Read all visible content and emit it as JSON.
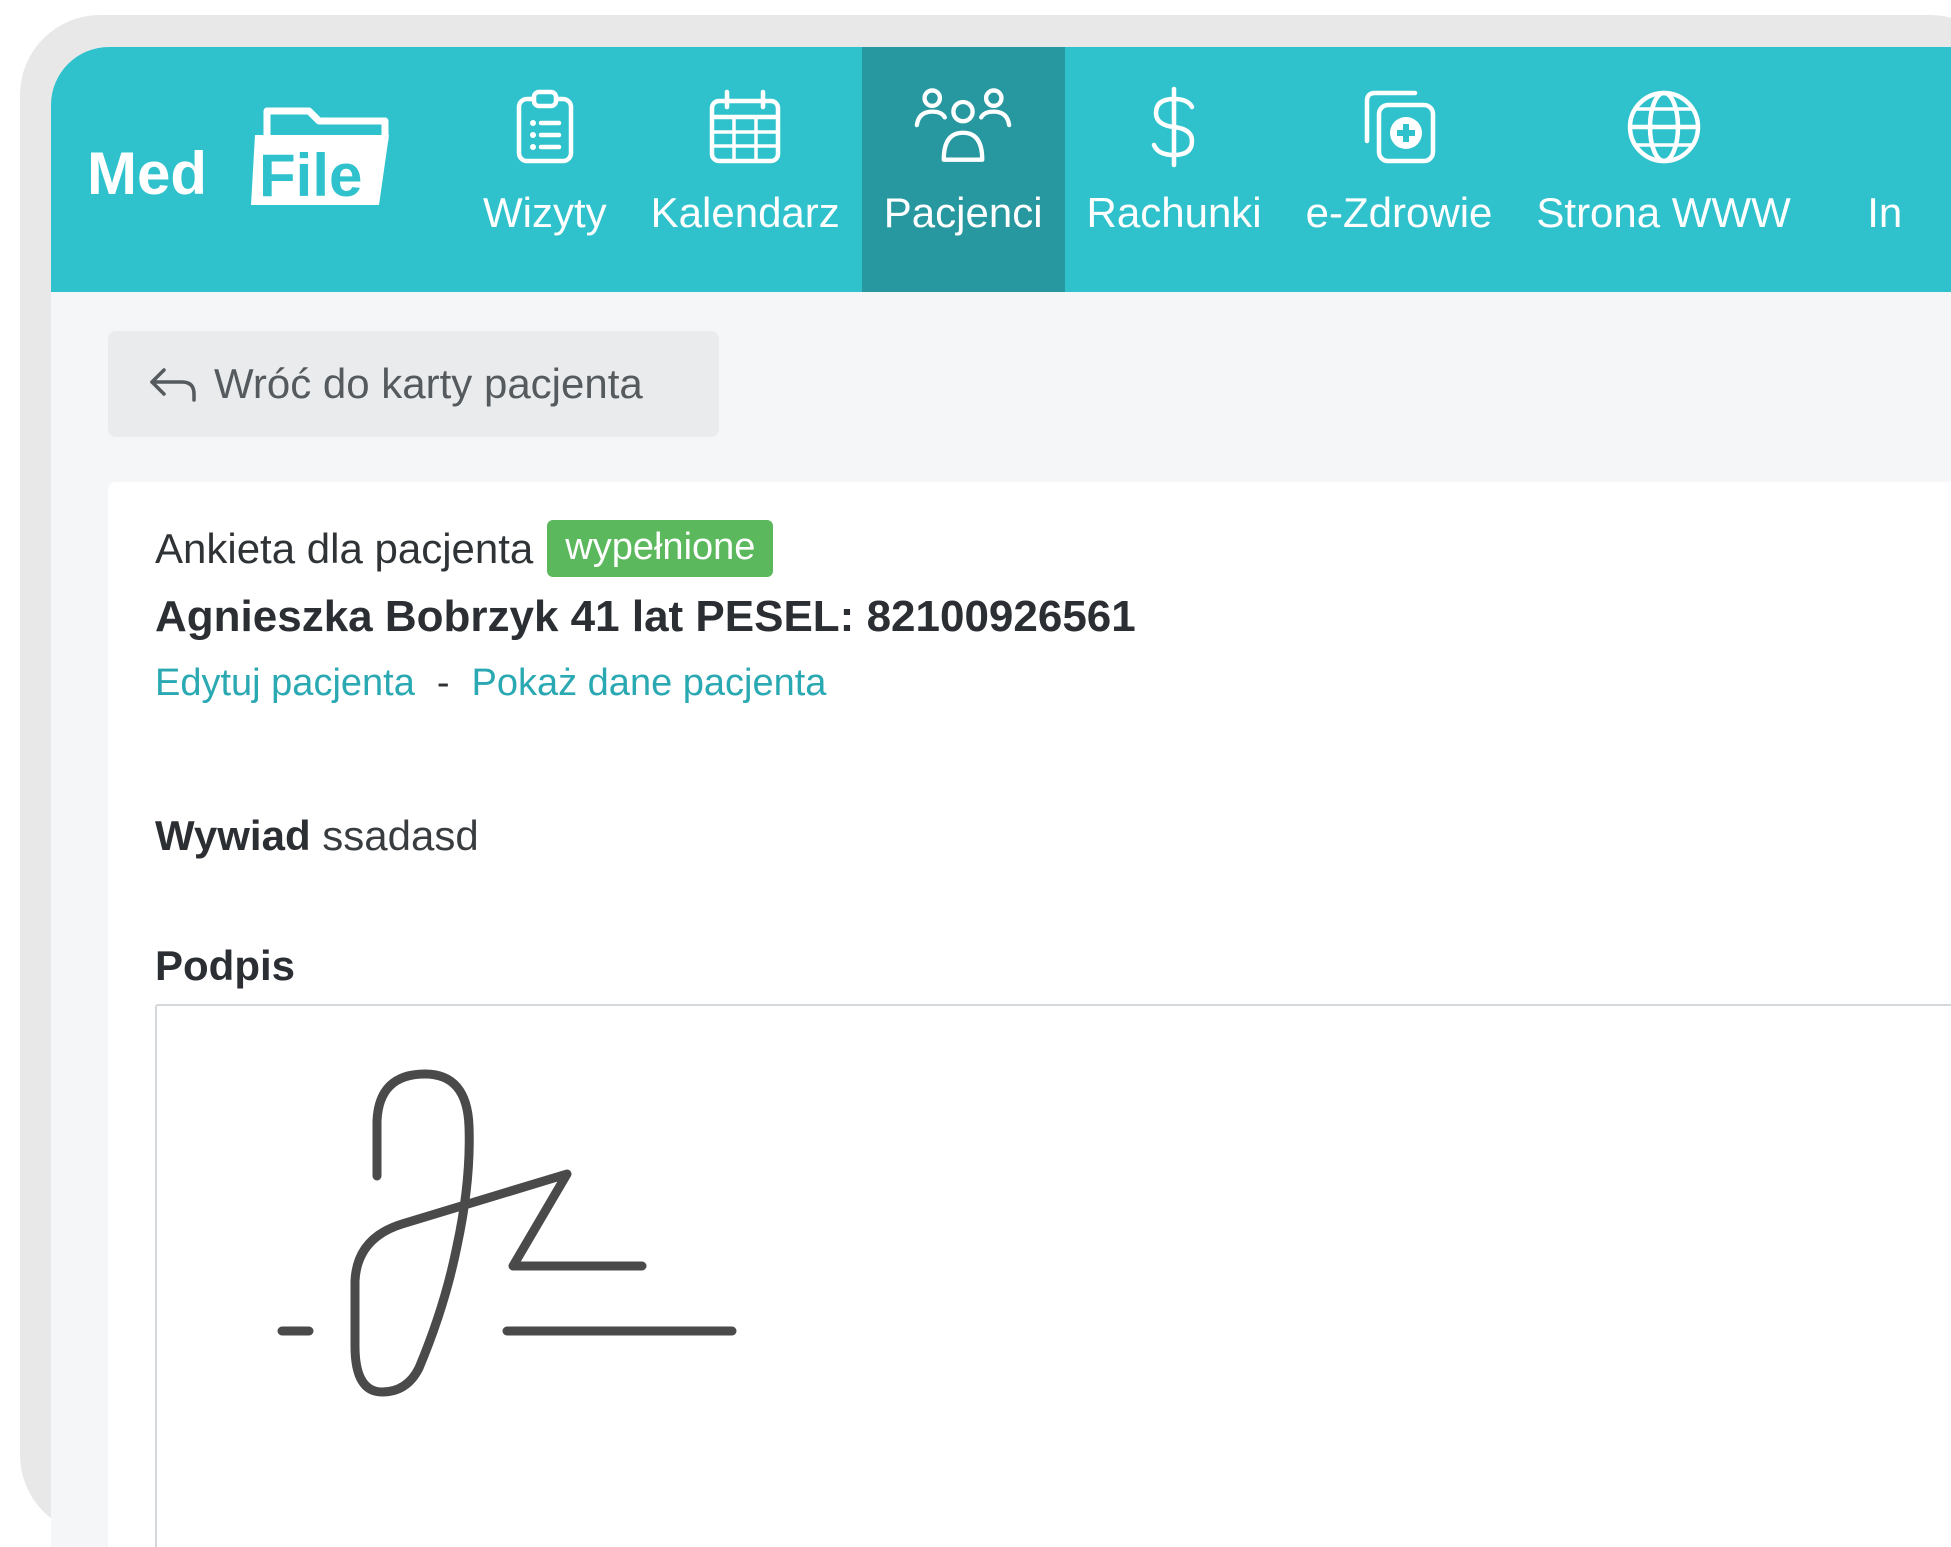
{
  "app": {
    "logo_part1": "Med",
    "logo_part2": "File"
  },
  "nav": {
    "items": [
      {
        "label": "Wizyty",
        "icon": "clipboard-list-icon",
        "active": false
      },
      {
        "label": "Kalendarz",
        "icon": "calendar-icon",
        "active": false
      },
      {
        "label": "Pacjenci",
        "icon": "users-icon",
        "active": true
      },
      {
        "label": "Rachunki",
        "icon": "dollar-icon",
        "active": false
      },
      {
        "label": "e-Zdrowie",
        "icon": "medical-cross-icon",
        "active": false
      },
      {
        "label": "Strona WWW",
        "icon": "globe-icon",
        "active": false
      },
      {
        "label": "In",
        "icon": "",
        "active": false
      }
    ]
  },
  "back_button": {
    "label": "Wróć do karty pacjenta",
    "icon": "back-arrow-icon"
  },
  "survey": {
    "title": "Ankieta dla pacjenta",
    "status_badge": "wypełnione"
  },
  "patient": {
    "summary": "Agnieszka Bobrzyk 41 lat PESEL: 82100926561",
    "edit_link": "Edytuj pacjenta",
    "separator": "-",
    "show_link": "Pokaż dane pacjenta"
  },
  "interview": {
    "label": "Wywiad",
    "value": "ssadasd"
  },
  "signature": {
    "label": "Podpis"
  },
  "colors": {
    "brand": "#2fc2cc",
    "nav_active": "#27989f",
    "badge": "#5cb85c",
    "link": "#2aa9b3"
  }
}
